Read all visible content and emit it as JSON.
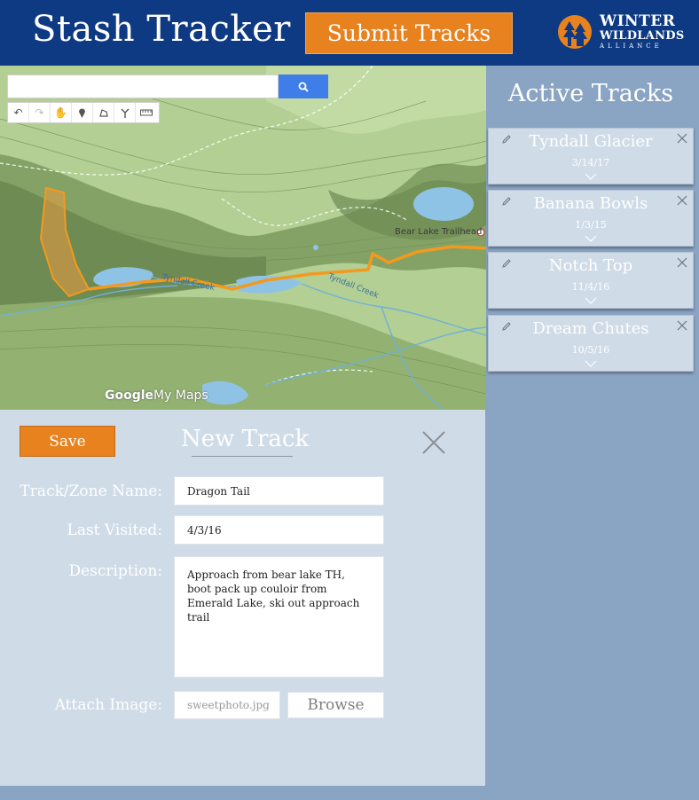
{
  "header": {
    "title": "Stash Tracker",
    "submit_label": "Submit Tracks",
    "logo": {
      "line1": "WINTER",
      "line2": "WILDLANDS",
      "line3": "ALLIANCE"
    }
  },
  "map": {
    "labels": {
      "trailhead": "Bear Lake Trailhead",
      "creek1": "Tyndall Creek",
      "creek2": "Tyndall Creek"
    },
    "credit": {
      "brand": "Google",
      "product": "My Maps"
    },
    "search_icon": "search-icon",
    "toolbar_icons": [
      "undo-icon",
      "redo-icon",
      "hand-icon",
      "marker-icon",
      "shape-icon",
      "route-icon",
      "ruler-icon"
    ]
  },
  "sidebar": {
    "title": "Active Tracks",
    "tracks": [
      {
        "name": "Tyndall Glacier",
        "date": "3/14/17"
      },
      {
        "name": "Banana Bowls",
        "date": "1/3/15"
      },
      {
        "name": "Notch Top",
        "date": "11/4/16"
      },
      {
        "name": "Dream Chutes",
        "date": "10/5/16"
      }
    ]
  },
  "form": {
    "save_label": "Save",
    "title": "New Track",
    "fields": {
      "name_label": "Track/Zone Name:",
      "name_value": "Dragon Tail",
      "visited_label": "Last Visited:",
      "visited_value": "4/3/16",
      "description_label": "Description:",
      "description_value": "Approach from bear lake TH, boot pack up couloir from Emerald Lake, ski out approach trail",
      "image_label": "Attach Image:",
      "image_placeholder": "sweetphoto.jpg",
      "browse_label": "Browse"
    }
  },
  "colors": {
    "header_bg": "#0e3a84",
    "accent_orange": "#e8821f",
    "panel_bg": "#cfdbe7",
    "page_bg": "#8aa4c3",
    "track_line": "#f39a1e",
    "search_btn": "#3f7ee8"
  }
}
